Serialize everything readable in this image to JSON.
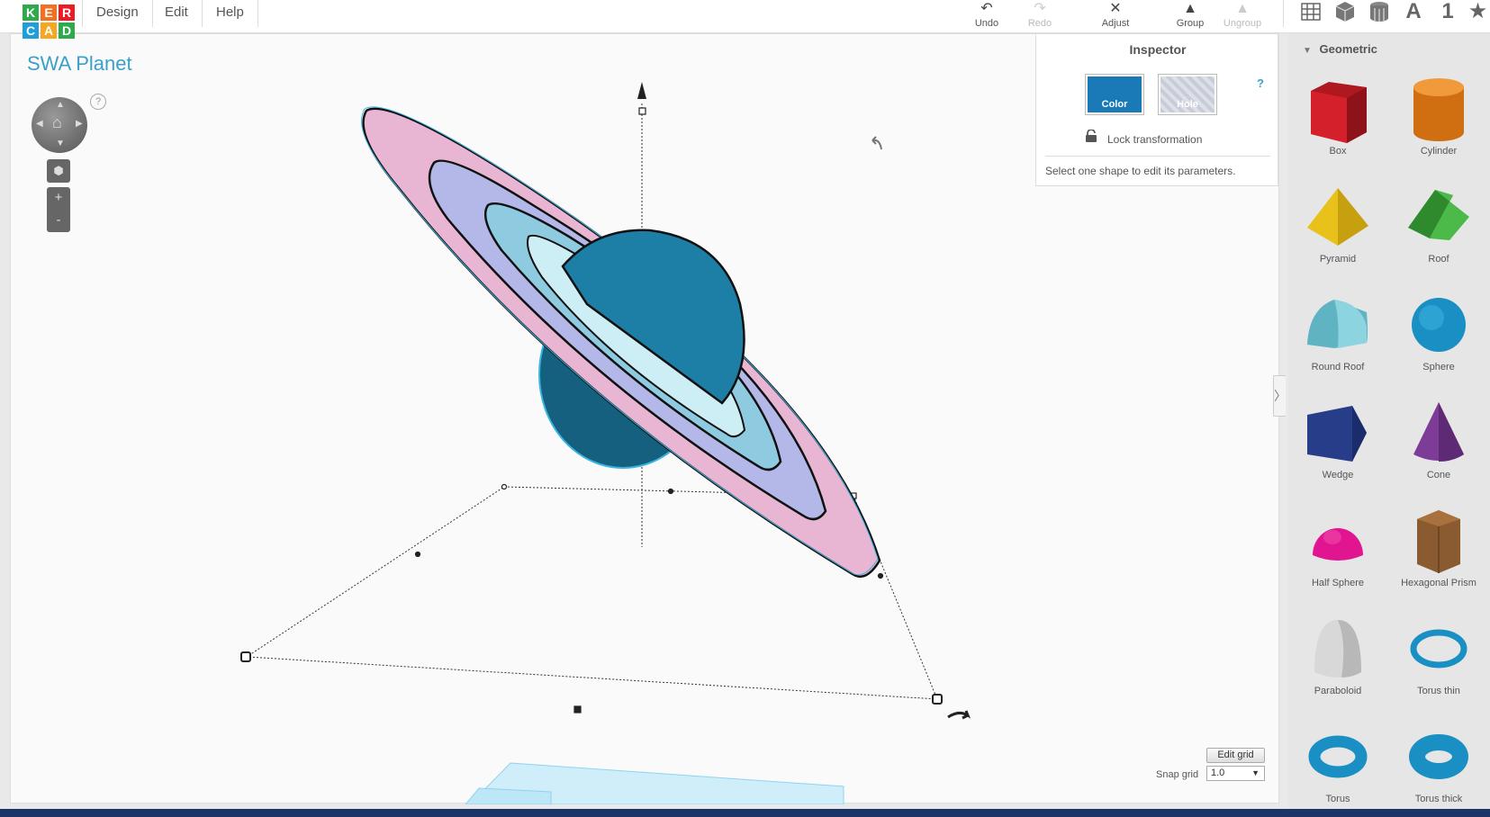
{
  "logo": {
    "letters": [
      "K",
      "E",
      "R",
      "C",
      "A",
      "D"
    ],
    "colors": [
      "#2ea94b",
      "#f36f21",
      "#ed1c24",
      "#1e9fd8",
      "#f5a623",
      "#2ea94b"
    ]
  },
  "menu": {
    "design": "Design",
    "edit": "Edit",
    "help": "Help"
  },
  "toolbar": {
    "undo": "Undo",
    "redo": "Redo",
    "adjust": "Adjust",
    "group": "Group",
    "ungroup": "Ungroup"
  },
  "right_icons": {
    "grid": "grid-icon",
    "box": "box-icon",
    "cylinder": "cylinder-icon",
    "text": "A",
    "number": "1",
    "star": "★"
  },
  "workplane": {
    "design_title": "SWA Planet",
    "help": "?",
    "zoom_in": "+",
    "zoom_out": "-",
    "edit_grid": "Edit grid",
    "snap_label": "Snap grid",
    "snap_value": "1.0"
  },
  "inspector": {
    "title": "Inspector",
    "color_label": "Color",
    "hole_label": "Hole",
    "help": "?",
    "lock_label": "Lock transformation",
    "message": "Select one shape to edit its parameters."
  },
  "library": {
    "header": "Geometric",
    "shapes": [
      {
        "label": "Box",
        "color": "#d4202a"
      },
      {
        "label": "Cylinder",
        "color": "#e8811c"
      },
      {
        "label": "Pyramid",
        "color": "#e8c21a"
      },
      {
        "label": "Roof",
        "color": "#3ea53c"
      },
      {
        "label": "Round Roof",
        "color": "#6fc2d0"
      },
      {
        "label": "Sphere",
        "color": "#1a8fc4"
      },
      {
        "label": "Wedge",
        "color": "#283d8a"
      },
      {
        "label": "Cone",
        "color": "#7d3c98"
      },
      {
        "label": "Half Sphere",
        "color": "#e0158f"
      },
      {
        "label": "Hexagonal Prism",
        "color": "#8a5a30"
      },
      {
        "label": "Paraboloid",
        "color": "#d8d8d8"
      },
      {
        "label": "Torus thin",
        "color": "#1a8fc4"
      },
      {
        "label": "Torus",
        "color": "#1a8fc4"
      },
      {
        "label": "Torus thick",
        "color": "#1a8fc4"
      }
    ]
  },
  "colors": {
    "accent": "#3aa0c8",
    "planet": "#1d7ea6",
    "ring_outer": "#e8b6d2",
    "ring_mid": "#b3b8e8",
    "ring_inner": "#8fcbe0"
  }
}
